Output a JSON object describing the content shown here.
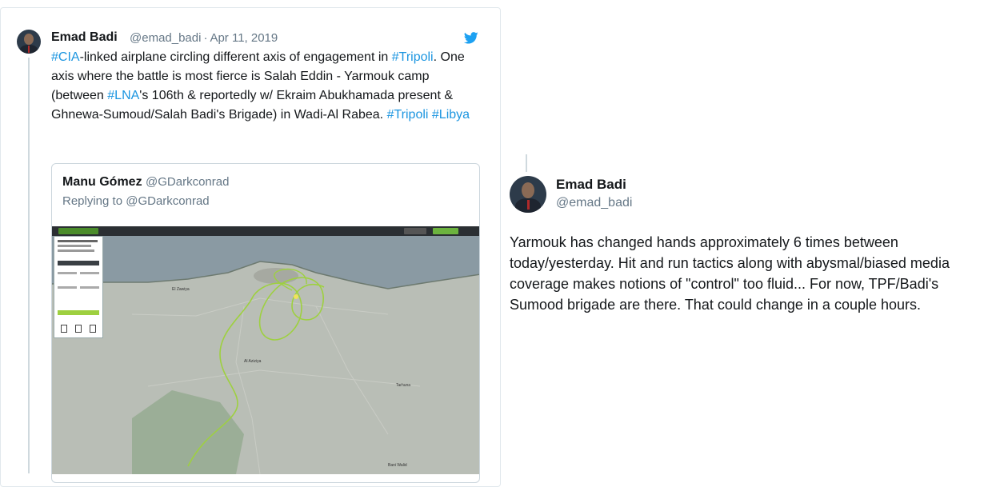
{
  "tweet": {
    "author_name": "Emad Badi",
    "handle": "@emad_badi",
    "separator": "·",
    "date": "Apr 11, 2019",
    "body": [
      {
        "text": "#CIA",
        "tag": true
      },
      {
        "text": "-linked airplane circling different axis of engagement in ",
        "tag": false
      },
      {
        "text": "#Tripoli",
        "tag": true
      },
      {
        "text": ". One axis where the battle is most fierce is Salah Eddin - Yarmouk camp (between ",
        "tag": false
      },
      {
        "text": "#LNA",
        "tag": true
      },
      {
        "text": "'s 106th & reportedly w/ Ekraim Abukhamada present & Ghnewa-Sumoud/Salah Badi's Brigade) in Wadi-Al Rabea. ",
        "tag": false
      },
      {
        "text": "#Tripoli",
        "tag": true
      },
      {
        "text": " ",
        "tag": false
      },
      {
        "text": "#Libya",
        "tag": true
      }
    ],
    "icons": {
      "avatar": "avatar-photo",
      "platform": "twitter-bird-icon"
    },
    "colors": {
      "link": "#1b95e0",
      "muted": "#657786"
    }
  },
  "quoted_tweet": {
    "author_name": "Manu Gómez",
    "handle": "@GDarkconrad",
    "replying_prefix": "Replying to ",
    "replying_to": "@GDarkconrad",
    "media": "flight-tracking-map-screenshot"
  },
  "reply_tweet": {
    "author_name": "Emad Badi",
    "handle": "@emad_badi",
    "body": "Yarmouk has changed hands approximately 6 times between today/yesterday. Hit and run tactics along with abysmal/biased media coverage makes notions of \"control\" too fluid... For now, TPF/Badi's Sumood brigade are there. That could change in a couple hours."
  }
}
